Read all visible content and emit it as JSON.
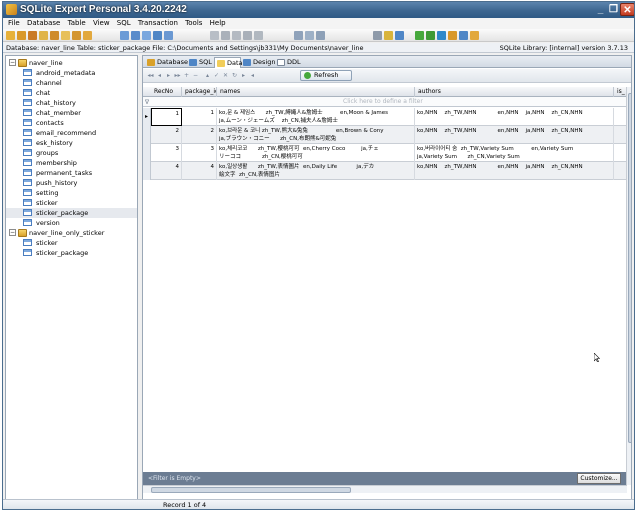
{
  "window": {
    "title": "SQLite Expert Personal 3.4.20.2242",
    "min_glyph": "_",
    "max_glyph": "❐",
    "close_glyph": "✕"
  },
  "menu": [
    "File",
    "Database",
    "Table",
    "View",
    "SQL",
    "Transaction",
    "Tools",
    "Help"
  ],
  "infobar": {
    "left": "Database: naver_line   Table: sticker_package   File: C:\\Documents and Settings\\jb331\\My Documents\\naver_line",
    "right": "SQLite Library: [internal] version 3.7.13"
  },
  "tree": {
    "db1": "naver_line",
    "db1_tables": [
      "android_metadata",
      "channel",
      "chat",
      "chat_history",
      "chat_member",
      "contacts",
      "email_recommend",
      "esk_history",
      "groups",
      "membership",
      "permanent_tasks",
      "push_history",
      "setting",
      "sticker",
      "sticker_package",
      "version"
    ],
    "selected": "sticker_package",
    "db2": "naver_line_only_sticker",
    "db2_tables": [
      "sticker",
      "sticker_package"
    ],
    "expander_glyph": "−"
  },
  "tabs": [
    "Database",
    "SQL",
    "Data",
    "Design",
    "DDL"
  ],
  "active_tab": "Data",
  "navigator": {
    "buttons": [
      "◂◂",
      "◂",
      "▸",
      "▸▸",
      "+",
      "−",
      "▴",
      "✓",
      "✕",
      "↻",
      "▸",
      "◂"
    ],
    "refresh_label": "Refresh"
  },
  "grid": {
    "columns": [
      "RecNo",
      "package_id",
      "names",
      "authors",
      "is_"
    ],
    "filter_placeholder": "Click here to define a filter",
    "filter_glyph": "∇",
    "row_indicator": "▸",
    "rows": [
      {
        "recno": "1",
        "package_id": "1",
        "names": "ko,문 & 제임스      zh_TW,縛繩人&詹姆士          en,Moon & James\nja,ムーン・ジェームズ    zh_CN,捕夫人&詹姆士",
        "authors": "ko,NHN    zh_TW,NHN            en,NHN    ja,NHN    zh_CN,NHN"
      },
      {
        "recno": "2",
        "package_id": "2",
        "names": "ko,브라운 & 코니 zh_TW,熊大&兔兔                en,Brown & Cony\nja,ブラウン・コニー      zh_CN,布朗熊&可妮兔",
        "authors": "ko,NHN    zh_TW,NHN            en,NHN    ja,NHN    zh_CN,NHN"
      },
      {
        "recno": "3",
        "package_id": "3",
        "names": "ko,체리코코      zh_TW,櫻桃可可  en,Cherry Coco         ja,チェ\nリーココ            zh_CN,樱桃可可",
        "authors": "ko,버라이어티 숨  zh_TW,Variety Sum          en,Variety Sum\nja,Variety Sum      zh_CN,Variety Sum"
      },
      {
        "recno": "4",
        "package_id": "4",
        "names": "ko,일상생활      zh_TW,表情圖片  en,Daily Life           ja,デカ\n絵文字  zh_CN,表情图片",
        "authors": "ko,NHN    zh_TW,NHN            en,NHN    ja,NHN    zh_CN,NHN"
      }
    ]
  },
  "filterbar": {
    "text": "<Filter is Empty>",
    "customize_label": "Customize..."
  },
  "status": "Record 1 of 4",
  "colors": {
    "titlebar": "#3d6690",
    "filterbar": "#6c7d93",
    "close": "#c23b21",
    "selection": "#e6e9ee"
  }
}
